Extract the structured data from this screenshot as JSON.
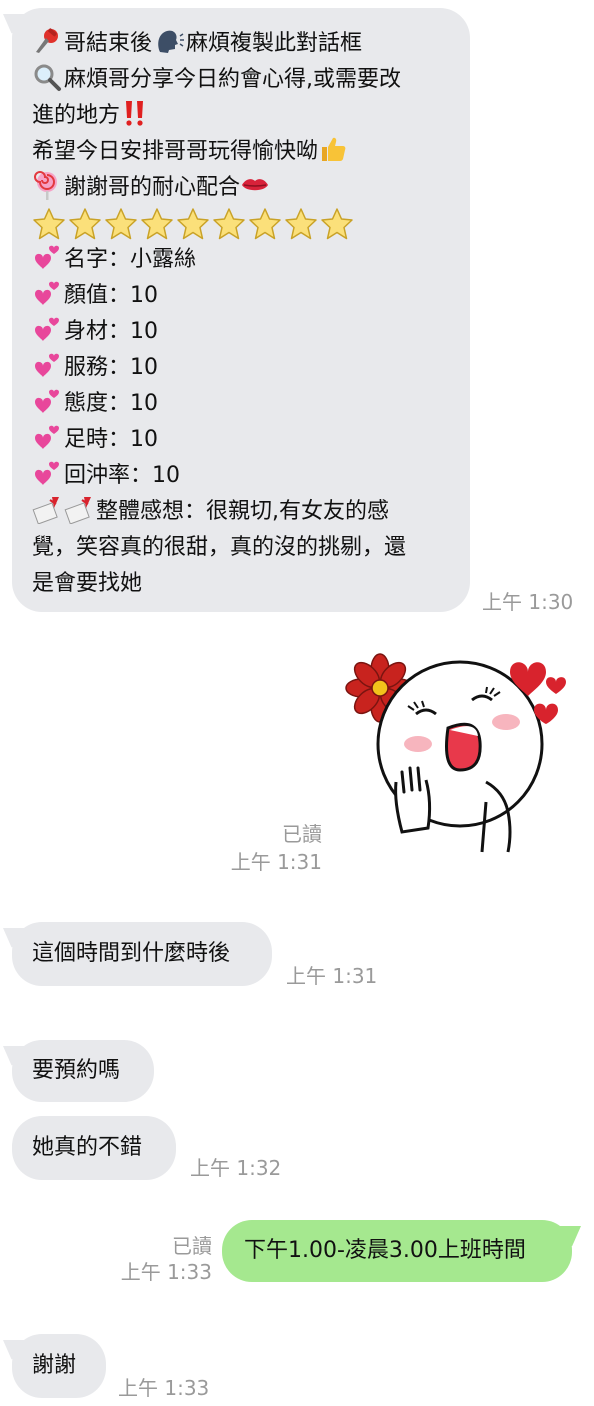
{
  "messages": {
    "m1": {
      "lines": {
        "l1": "哥結束後",
        "l1b": "麻煩複製此對話框",
        "l2": "麻煩哥分享今日約會心得,或需要改",
        "l3": "進的地方",
        "l4": "希望今日安排哥哥玩得愉快呦",
        "l5": "謝謝哥的耐心配合",
        "l7": "名字：小露絲",
        "l8": "顏值：10",
        "l9": "身材：10",
        "l10": "服務：10",
        "l11": "態度：10",
        "l12": "足時：10",
        "l13": "回沖率：10",
        "l14": "整體感想：很親切,有女友的感",
        "l15": "覺，笑容真的很甜，真的沒的挑剔，還",
        "l16": "是會要找她"
      },
      "time": "上午 1:30",
      "stars_count": 9
    },
    "sticker": {
      "read": "已讀",
      "time": "上午 1:31"
    },
    "m2": {
      "text": "這個時間到什麼時後",
      "time": "上午 1:31"
    },
    "m3": {
      "text": "要預約嗎"
    },
    "m4": {
      "text": "她真的不錯",
      "time": "上午 1:32"
    },
    "m5": {
      "text": "下午1.00-凌晨3.00上班時間",
      "read": "已讀",
      "time": "上午 1:33"
    },
    "m6": {
      "text": "謝謝",
      "time": "上午 1:33"
    }
  },
  "icons": {
    "pushpin": "pushpin-icon",
    "speaking_head": "speaking-head-icon",
    "magnifier": "magnifying-glass-icon",
    "double_exclamation": "double-exclamation-icon",
    "thumbs_up": "thumbs-up-icon",
    "lollipop": "lollipop-icon",
    "kiss_lips": "kiss-mark-icon",
    "star": "star-icon",
    "heart": "two-hearts-icon",
    "love_letter": "love-letter-icon"
  },
  "colors": {
    "incoming_bubble": "#e8e9ec",
    "outgoing_bubble": "#a5e88f",
    "meta_text": "#9a9a9a"
  }
}
